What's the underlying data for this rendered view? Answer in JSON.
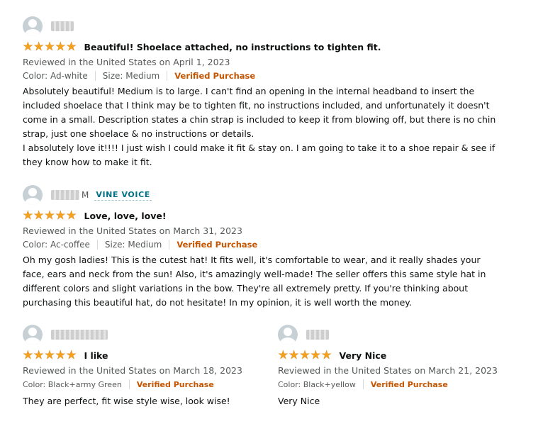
{
  "reviews": [
    {
      "reviewer_suffix": "",
      "badge": "",
      "rating": 5,
      "title": "Beautiful! Shoelace attached, no instructions to tighten fit.",
      "date": "Reviewed in the United States on April 1, 2023",
      "color": "Color: Ad-white",
      "size": "Size: Medium",
      "verified": "Verified Purchase",
      "body": [
        "Absolutely beautiful! Medium is to large. I can't find an opening in the internal headband to insert the included shoelace that I think may be to tighten fit, no instructions included, and unfortunately it doesn't come in a small. Description states a chin strap is included to keep it from blowing off, but there is no chin strap, just one shoelace & no instructions or details.",
        "I absolutely love it!!!! I just wish I could make it fit & stay on. I am going to take it to a shoe repair & see if they know how to make it fit."
      ]
    },
    {
      "reviewer_suffix": "M",
      "badge": "VINE VOICE",
      "rating": 5,
      "title": "Love, love, love!",
      "date": "Reviewed in the United States on March 31, 2023",
      "color": "Color: Ac-coffee",
      "size": "Size: Medium",
      "verified": "Verified Purchase",
      "body": [
        "Oh my gosh ladies! This is the cutest hat! It fits well, it's comfortable to wear, and it really shades your face, ears and neck from the sun! Also, it's amazingly well-made! The seller offers this same style hat in different colors and slight variations in the bow. They're all extremely pretty. If you're thinking about purchasing this beautiful hat, do not hesitate! In my opinion, it is well worth the money."
      ]
    },
    {
      "reviewer_suffix": "",
      "badge": "",
      "rating": 5,
      "title": "I like",
      "date": "Reviewed in the United States on March 18, 2023",
      "color": "Color: Black+army Green",
      "size": "",
      "verified": "Verified Purchase",
      "body": [
        "They are perfect, fit wise style wise, look wise!"
      ]
    },
    {
      "reviewer_suffix": "",
      "badge": "",
      "rating": 5,
      "title": "Very Nice",
      "date": "Reviewed in the United States on March 21, 2023",
      "color": "Color: Black+yellow",
      "size": "",
      "verified": "Verified Purchase",
      "body": [
        "Very Nice"
      ]
    }
  ],
  "colors": {
    "star": "#f4a21b",
    "verified": "#c45500",
    "vine": "#007185"
  },
  "icons": {
    "avatar": "default-avatar-icon",
    "star": "star-filled-icon"
  }
}
